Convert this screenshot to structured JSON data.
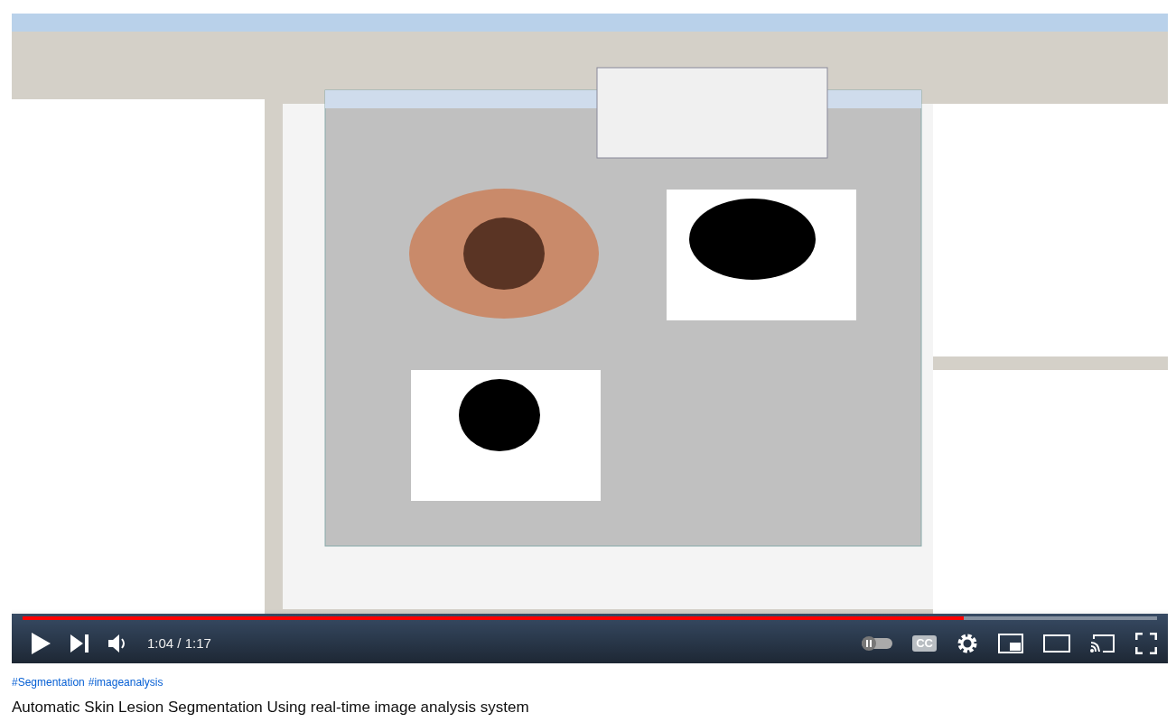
{
  "player": {
    "progress": {
      "level": 0.83
    },
    "time": "1:04 / 1:17",
    "captions_label": "CC"
  },
  "hashtags": [
    "#Segmentation",
    "#imageanalysis"
  ],
  "title": "Automatic Skin Lesion Segmentation Using real-time image analysis system"
}
